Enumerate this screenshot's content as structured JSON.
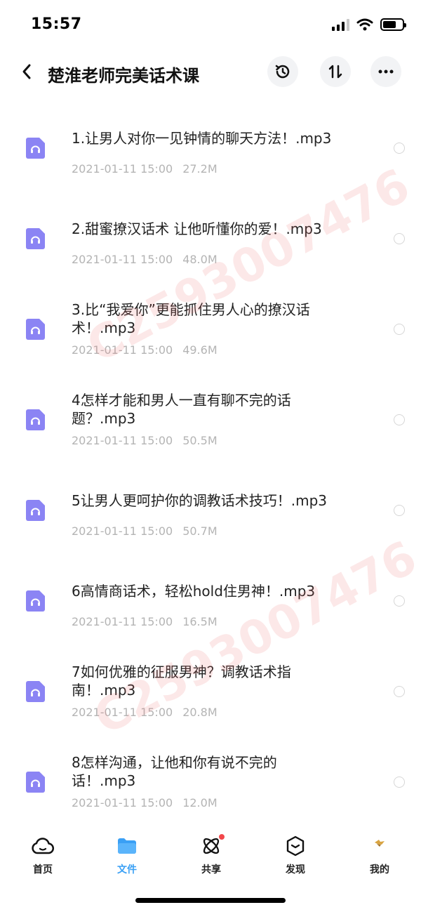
{
  "status_bar": {
    "time": "15:57"
  },
  "header": {
    "title": "楚淮老师完美话术课"
  },
  "files": [
    {
      "name": "1.让男人对你一见钟情的聊天方法！.mp3",
      "date": "2021-01-11 15:00",
      "size": "27.2M"
    },
    {
      "name": "2.甜蜜撩汉话术 让他听懂你的爱！.mp3",
      "date": "2021-01-11 15:00",
      "size": "48.0M"
    },
    {
      "name": "3.比“我爱你”更能抓住男人心的撩汉话术！.mp3",
      "date": "2021-01-11 15:00",
      "size": "49.6M"
    },
    {
      "name": "4怎样才能和男人一直有聊不完的话题？.mp3",
      "date": "2021-01-11 15:00",
      "size": "50.5M"
    },
    {
      "name": "5让男人更呵护你的调教话术技巧！.mp3",
      "date": "2021-01-11 15:00",
      "size": "50.7M"
    },
    {
      "name": "6高情商话术，轻松hold住男神！.mp3",
      "date": "2021-01-11 15:00",
      "size": "16.5M"
    },
    {
      "name": "7如何优雅的征服男神？调教话术指南！.mp3",
      "date": "2021-01-11 15:00",
      "size": "20.8M"
    },
    {
      "name": "8怎样沟通，让他和你有说不完的话！.mp3",
      "date": "2021-01-11 15:00",
      "size": "12.0M"
    }
  ],
  "watermark": {
    "text": "C2593007476"
  },
  "bottom_nav": {
    "home": "首页",
    "files": "文件",
    "share": "共享",
    "discover": "发现",
    "mine": "我的"
  },
  "colors": {
    "accent": "#3aa0f5",
    "file_icon": "#8b84f4",
    "meta_text": "#b4b4b4",
    "badge": "#f2474a"
  }
}
